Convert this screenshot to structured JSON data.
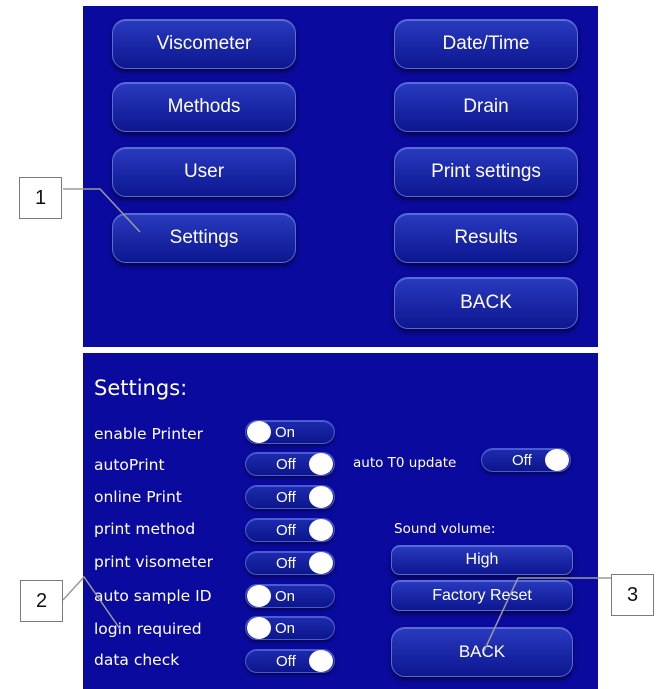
{
  "main_menu": {
    "left_buttons": [
      "Viscometer",
      "Methods",
      "User",
      "Settings"
    ],
    "right_buttons": [
      "Date/Time",
      "Drain",
      "Print settings",
      "Results",
      "BACK"
    ]
  },
  "settings": {
    "title": "Settings:",
    "rows": [
      {
        "label": "enable Printer",
        "state": "On"
      },
      {
        "label": "autoPrint",
        "state": "Off"
      },
      {
        "label": "online Print",
        "state": "Off"
      },
      {
        "label": "print method",
        "state": "Off"
      },
      {
        "label": "print visometer",
        "state": "Off"
      },
      {
        "label": "auto sample ID",
        "state": "On"
      },
      {
        "label": "login required",
        "state": "On"
      },
      {
        "label": "data check",
        "state": "Off"
      }
    ],
    "auto_t0": {
      "label": "auto T0 update",
      "state": "Off"
    },
    "sound_volume": {
      "label": "Sound volume:",
      "value": "High"
    },
    "factory_reset": "Factory Reset",
    "back": "BACK"
  },
  "callouts": [
    "1",
    "2",
    "3"
  ],
  "colors": {
    "panel_bg": "#0a0a9e",
    "button_top": "#2a3bbf",
    "button_bottom": "#0d1790",
    "text": "#ffffff"
  }
}
